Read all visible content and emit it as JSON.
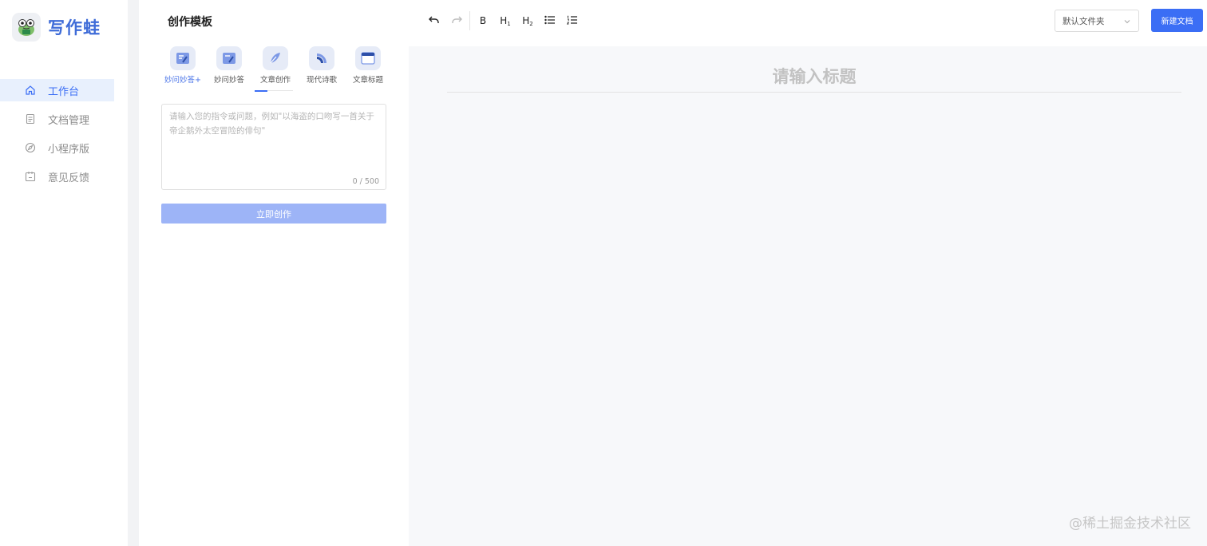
{
  "app": {
    "name": "写作蛙"
  },
  "sidebar": {
    "items": [
      {
        "label": "工作台",
        "icon": "home-icon",
        "active": true
      },
      {
        "label": "文档管理",
        "icon": "document-icon",
        "active": false
      },
      {
        "label": "小程序版",
        "icon": "compass-icon",
        "active": false
      },
      {
        "label": "意见反馈",
        "icon": "feedback-icon",
        "active": false
      }
    ]
  },
  "templates": {
    "title": "创作模板",
    "tabs": [
      {
        "label": "妙问妙答+",
        "icon": "qa-plus-icon"
      },
      {
        "label": "妙问妙答",
        "icon": "qa-icon"
      },
      {
        "label": "文章创作",
        "icon": "feather-icon"
      },
      {
        "label": "现代诗歌",
        "icon": "fan-icon"
      },
      {
        "label": "文章标题",
        "icon": "window-icon"
      }
    ],
    "prompt_placeholder": "请输入您的指令或问题，例如\"以海盗的口吻写一首关于帝企鹅外太空冒险的俳句\"",
    "counter": "0 / 500",
    "create_label": "立即创作"
  },
  "toolbar": {
    "undo_icon": "undo-icon",
    "redo_icon": "redo-icon",
    "bold": "B",
    "h1": "H",
    "h1_sub": "1",
    "h2": "H",
    "h2_sub": "2",
    "bullet_icon": "bullet-list-icon",
    "ordered_icon": "ordered-list-icon"
  },
  "header": {
    "folder": "默认文件夹",
    "new_doc": "新建文档"
  },
  "editor": {
    "title_placeholder": "请输入标题"
  },
  "watermark": "@稀土掘金技术社区",
  "colors": {
    "accent": "#3b6ef5",
    "active_bg": "#e8f0fd",
    "disabled_button": "#9db4f7"
  }
}
